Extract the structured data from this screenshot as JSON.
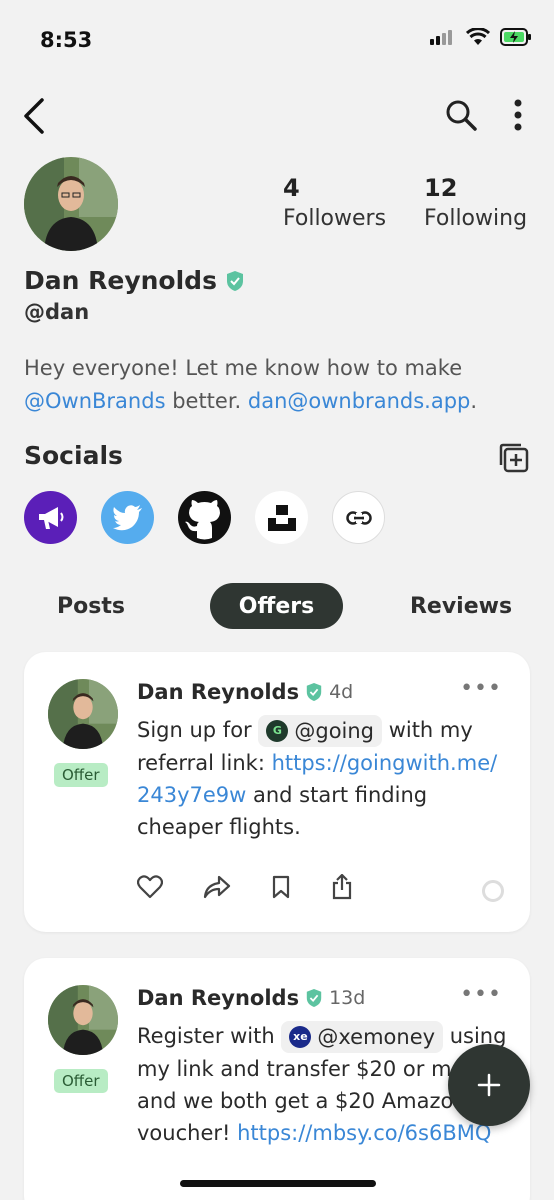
{
  "status": {
    "time": "8:53"
  },
  "profile": {
    "name": "Dan Reynolds",
    "handle": "@dan",
    "followers_count": "4",
    "followers_label": "Followers",
    "following_count": "12",
    "following_label": "Following",
    "bio_1": "Hey everyone! Let me know how to make ",
    "bio_mention": "@OwnBrands",
    "bio_2": " better. ",
    "bio_email": "dan@ownbrands.app",
    "bio_3": "."
  },
  "socials": {
    "title": "Socials",
    "items": [
      "megaphone-icon",
      "twitter-icon",
      "github-icon",
      "unsplash-icon",
      "link-icon"
    ]
  },
  "tabs": [
    "Posts",
    "Offers",
    "Reviews"
  ],
  "posts": [
    {
      "name": "Dan Reynolds",
      "time": "4d",
      "badge": "Offer",
      "t1": "Sign up for ",
      "chip": "@going",
      "t2": " with my referral link: ",
      "link": "https://goingwith.me/243y7e9w",
      "t3": " and start finding cheaper flights."
    },
    {
      "name": "Dan Reynolds",
      "time": "13d",
      "badge": "Offer",
      "t1": "Register with ",
      "chip": "@xemoney",
      "chip_icon": "xe",
      "t2": " using my link and transfer $20 or more and we both get a $20 Amazon voucher! ",
      "link": "https://mbsy.co/6s6BMQ"
    }
  ],
  "colors": {
    "accent": "#3a87d6",
    "dark": "#2f3632",
    "verified": "#5cc3a0",
    "offer_badge": "#b8ecc4"
  }
}
